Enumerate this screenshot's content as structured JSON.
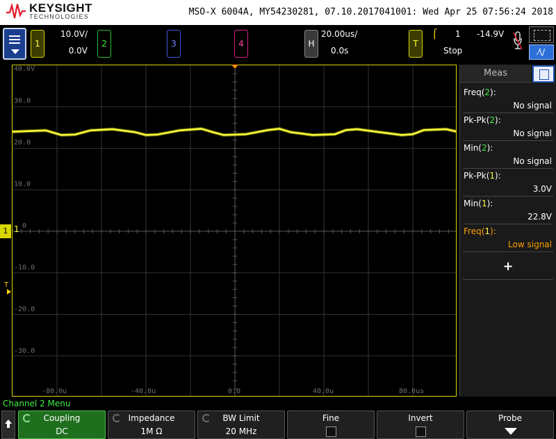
{
  "header": {
    "brand": "KEYSIGHT",
    "brand_sub": "TECHNOLOGIES",
    "device_info": "MSO-X 6004A, MY54230281, 07.10.2017041001: Wed Apr 25 07:56:24 2018"
  },
  "channels": {
    "ch1": {
      "label": "1",
      "scale": "10.0V/",
      "offset": "0.0V",
      "color": "#ffff40"
    },
    "ch2": {
      "label": "2",
      "color": "#44ee44"
    },
    "ch3": {
      "label": "3",
      "color": "#6f86ff"
    },
    "ch4": {
      "label": "4",
      "color": "#ff4aa5"
    }
  },
  "horizontal": {
    "label": "H",
    "scale": "20.00us/",
    "delay": "0.0s"
  },
  "trigger": {
    "label": "T",
    "source": "1",
    "level": "-14.9V",
    "status": "Stop",
    "icon": "rising-edge-icon"
  },
  "waveform_button": {
    "label": "⁄\\/"
  },
  "graticule": {
    "y_labels": [
      "40.0V",
      "30.0",
      "20.0",
      "10.0",
      "0",
      "-10.0",
      "-20.0",
      "-30.0"
    ],
    "x_labels": [
      "-80.0u",
      "-40.0u",
      "0.0",
      "40.0u",
      "80.0us"
    ],
    "ch1_marker": "1",
    "ch1_side_label": "1",
    "trigger_marker": "T"
  },
  "chart_data": {
    "type": "line",
    "title": "",
    "xlabel": "",
    "ylabel": "",
    "x_unit": "us",
    "y_unit": "V",
    "xlim": [
      -100,
      100
    ],
    "ylim": [
      -40,
      40
    ],
    "series": [
      {
        "x": [
          -100,
          -85,
          -78,
          -72,
          -65,
          -55,
          -45,
          -40,
          -35,
          -25,
          -15,
          -10,
          -5,
          5,
          15,
          20,
          25,
          35,
          45,
          50,
          55,
          65,
          75,
          80,
          85,
          95,
          100
        ],
        "y": [
          24.0,
          24.3,
          23.2,
          23.3,
          24.3,
          24.6,
          23.9,
          23.2,
          23.3,
          24.3,
          24.7,
          23.9,
          23.2,
          23.4,
          24.4,
          24.7,
          23.9,
          23.2,
          23.4,
          24.4,
          24.6,
          23.9,
          23.2,
          23.4,
          24.4,
          24.6,
          24.0
        ]
      }
    ]
  },
  "measurements": {
    "tab_label": "Meas",
    "items": [
      {
        "name": "Freq",
        "channel": "2",
        "value": "No signal"
      },
      {
        "name": "Pk-Pk",
        "channel": "2",
        "value": "No signal"
      },
      {
        "name": "Min",
        "channel": "2",
        "value": "No signal"
      },
      {
        "name": "Pk-Pk",
        "channel": "1",
        "value": "3.0V"
      },
      {
        "name": "Min",
        "channel": "1",
        "value": "22.8V"
      },
      {
        "name": "Freq",
        "channel": "1",
        "value": "Low signal"
      }
    ],
    "add_label": "+"
  },
  "softkeys": {
    "menu_title": "Channel 2 Menu",
    "coupling": {
      "label": "Coupling",
      "value": "DC"
    },
    "impedance": {
      "label": "Impedance",
      "value": "1M Ω"
    },
    "bw_limit": {
      "label": "BW Limit",
      "value": "20 MHz"
    },
    "fine": {
      "label": "Fine"
    },
    "invert": {
      "label": "Invert"
    },
    "probe": {
      "label": "Probe"
    }
  }
}
